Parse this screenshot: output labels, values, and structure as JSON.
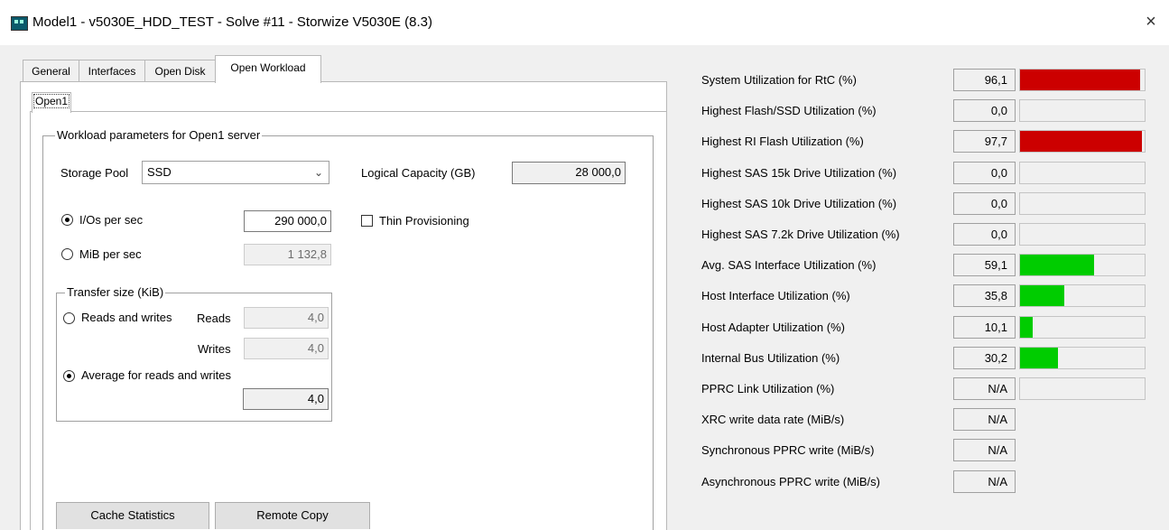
{
  "window": {
    "title": "Model1 - v5030E_HDD_TEST - Solve #11 - Storwize V5030E (8.3)",
    "close_symbol": "×"
  },
  "tabs": [
    {
      "label": "General",
      "active": false
    },
    {
      "label": "Interfaces",
      "active": false
    },
    {
      "label": "Open Disk",
      "active": false
    },
    {
      "label": "Open Workload",
      "active": true
    }
  ],
  "subtab": {
    "label": "Open1"
  },
  "workload": {
    "group_title": "Workload parameters for Open1 server",
    "storage_pool_label": "Storage Pool",
    "storage_pool_value": "SSD",
    "logical_capacity_label": "Logical Capacity (GB)",
    "logical_capacity_value": "28 000,0",
    "ios_label": "I/Os per sec",
    "ios_value": "290 000,0",
    "ios_selected": true,
    "mib_label": "MiB per sec",
    "mib_value": "1 132,8",
    "thin_provisioning_label": "Thin Provisioning",
    "thin_provisioning_checked": false
  },
  "transfer": {
    "group_title": "Transfer size (KiB)",
    "reads_writes_label": "Reads and writes",
    "reads_label": "Reads",
    "reads_value": "4,0",
    "writes_label": "Writes",
    "writes_value": "4,0",
    "average_label": "Average for reads and writes",
    "average_value": "4,0",
    "average_selected": true
  },
  "buttons": {
    "cache_statistics": "Cache Statistics",
    "remote_copy": "Remote Copy"
  },
  "metrics": [
    {
      "label": "System Utilization for RtC (%)",
      "value": "96,1",
      "level": 0.961,
      "color": "#cc0000",
      "bar": true
    },
    {
      "label": "Highest Flash/SSD Utilization (%)",
      "value": "0,0",
      "level": 0.0,
      "color": "#cc0000",
      "bar": true
    },
    {
      "label": "Highest RI Flash Utilization (%)",
      "value": "97,7",
      "level": 0.977,
      "color": "#cc0000",
      "bar": true
    },
    {
      "label": "Highest SAS 15k Drive Utilization (%)",
      "value": "0,0",
      "level": 0.0,
      "color": "#cc0000",
      "bar": true
    },
    {
      "label": "Highest SAS 10k Drive Utilization (%)",
      "value": "0,0",
      "level": 0.0,
      "color": "#cc0000",
      "bar": true
    },
    {
      "label": "Highest SAS 7.2k Drive Utilization (%)",
      "value": "0,0",
      "level": 0.0,
      "color": "#cc0000",
      "bar": true
    },
    {
      "label": "Avg. SAS Interface Utilization (%)",
      "value": "59,1",
      "level": 0.591,
      "color": "#00cc00",
      "bar": true
    },
    {
      "label": "Host Interface Utilization (%)",
      "value": "35,8",
      "level": 0.358,
      "color": "#00cc00",
      "bar": true
    },
    {
      "label": "Host Adapter Utilization (%)",
      "value": "10,1",
      "level": 0.101,
      "color": "#00cc00",
      "bar": true
    },
    {
      "label": "Internal Bus Utilization (%)",
      "value": "30,2",
      "level": 0.302,
      "color": "#00cc00",
      "bar": true
    },
    {
      "label": "PPRC Link Utilization (%)",
      "value": "N/A",
      "level": 0.0,
      "color": "#00cc00",
      "bar": true
    },
    {
      "label": "XRC write data rate (MiB/s)",
      "value": "N/A",
      "bar": false
    },
    {
      "label": "Synchronous PPRC write (MiB/s)",
      "value": "N/A",
      "bar": false
    },
    {
      "label": "Asynchronous PPRC write (MiB/s)",
      "value": "N/A",
      "bar": false
    }
  ]
}
